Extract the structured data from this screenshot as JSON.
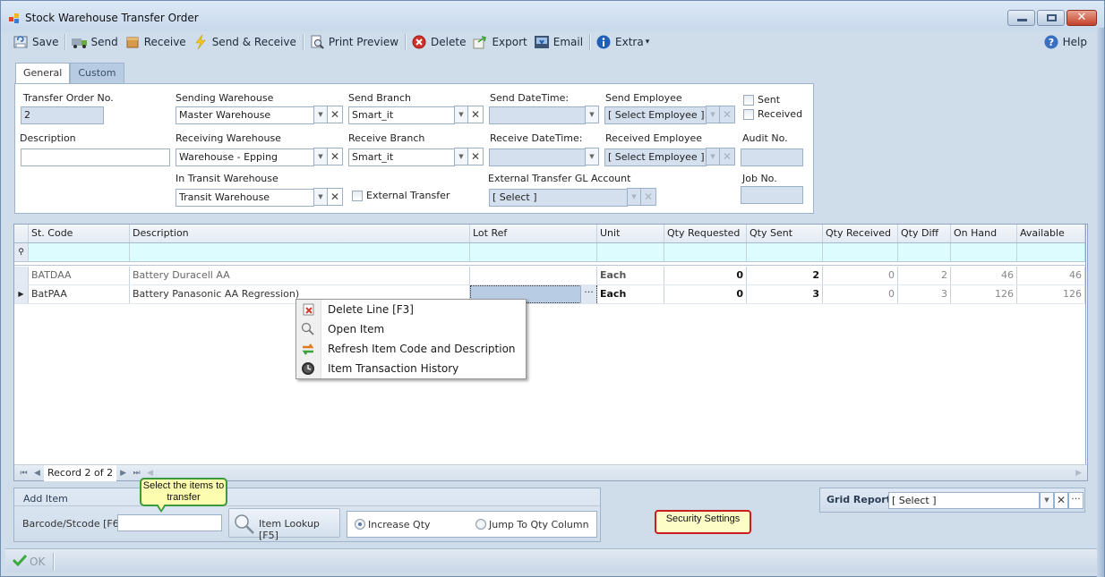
{
  "window": {
    "title": "Stock Warehouse Transfer Order",
    "controls": {
      "minimize": "minimize",
      "maximize": "maximize",
      "close": "✕"
    }
  },
  "toolbar": {
    "items": [
      {
        "label": "Save",
        "icon": "save-icon"
      },
      {
        "label": "Send",
        "icon": "truck-icon"
      },
      {
        "label": "Receive",
        "icon": "box-icon"
      },
      {
        "label": "Send & Receive",
        "icon": "lightning-icon"
      },
      {
        "label": "Print Preview",
        "icon": "print-preview-icon"
      },
      {
        "label": "Delete",
        "icon": "delete-icon"
      },
      {
        "label": "Export",
        "icon": "export-icon"
      },
      {
        "label": "Email",
        "icon": "email-icon"
      },
      {
        "label": "Extra",
        "icon": "info-icon",
        "dropdown": "▾"
      }
    ],
    "help": {
      "label": "Help",
      "icon": "help-icon"
    }
  },
  "tabs": [
    {
      "label": "General",
      "active": true
    },
    {
      "label": "Custom",
      "active": false
    }
  ],
  "general": {
    "transfer_order_no": {
      "label": "Transfer Order No.",
      "value": "2"
    },
    "description": {
      "label": "Description",
      "value": ""
    },
    "sending_warehouse": {
      "label": "Sending Warehouse",
      "value": "Master Warehouse"
    },
    "receiving_warehouse": {
      "label": "Receiving Warehouse",
      "value": "Warehouse - Epping"
    },
    "in_transit_warehouse": {
      "label": "In Transit Warehouse",
      "value": "Transit Warehouse"
    },
    "send_branch": {
      "label": "Send Branch",
      "value": "Smart_it"
    },
    "receive_branch": {
      "label": "Receive Branch",
      "value": "Smart_it"
    },
    "external_transfer": {
      "label": "External Transfer",
      "checked": false
    },
    "send_datetime": {
      "label": "Send DateTime:",
      "value": ""
    },
    "receive_datetime": {
      "label": "Receive DateTime:",
      "value": ""
    },
    "external_gl_account": {
      "label": "External Transfer GL Account",
      "value": "[ Select ]"
    },
    "send_employee": {
      "label": "Send Employee",
      "value": "[ Select Employee ]"
    },
    "received_employee": {
      "label": "Received Employee",
      "value": "[ Select Employee ]"
    },
    "sent": {
      "label": "Sent",
      "checked": false
    },
    "received": {
      "label": "Received",
      "checked": false
    },
    "audit_no": {
      "label": "Audit No.",
      "value": ""
    },
    "job_no": {
      "label": "Job No.",
      "value": ""
    }
  },
  "grid": {
    "columns": [
      "St. Code",
      "Description",
      "Lot Ref",
      "Unit",
      "Qty Requested",
      "Qty Sent",
      "Qty Received",
      "Qty Diff",
      "On Hand",
      "Available"
    ],
    "rows": [
      {
        "st_code": "BATDAA",
        "description": "Battery Duracell AA",
        "lot_ref": "",
        "unit": "Each",
        "qty_requested": "0",
        "qty_sent": "2",
        "qty_received": "0",
        "qty_diff": "2",
        "on_hand": "46",
        "available": "46"
      },
      {
        "st_code": "BatPAA",
        "description": "Battery Panasonic AA Regression)",
        "lot_ref": "",
        "unit": "Each",
        "qty_requested": "0",
        "qty_sent": "3",
        "qty_received": "0",
        "qty_diff": "3",
        "on_hand": "126",
        "available": "126"
      }
    ],
    "focused_row": 2,
    "navigator": {
      "record_text": "Record 2 of 2",
      "first": "⏮",
      "prev": "◀",
      "next": "▶",
      "last": "⏭"
    },
    "lot_ellipsis": "···"
  },
  "context_menu": {
    "items": [
      {
        "label": "Delete Line [F3]",
        "icon": "delete-line-icon"
      },
      {
        "label": "Open Item",
        "icon": "magnifier-icon"
      },
      {
        "label": "Refresh Item Code and Description",
        "icon": "refresh-icon"
      },
      {
        "label": "Item Transaction History",
        "icon": "history-clock-icon"
      }
    ]
  },
  "add_item": {
    "title": "Add Item",
    "barcode_label": "Barcode/Stcode [F6]",
    "barcode_value": "",
    "lookup_label": "Item Lookup [F5]",
    "radio_options": [
      {
        "label": "Increase Qty",
        "selected": true
      },
      {
        "label": "Jump To Qty Column",
        "selected": false
      }
    ]
  },
  "callouts": {
    "select_items": "Select the items to transfer",
    "security_settings": "Security Settings"
  },
  "grid_report": {
    "label": "Grid Report:",
    "value": "[ Select ]"
  },
  "statusbar": {
    "ok_label": "OK"
  },
  "colors": {
    "window_bg": "#cfdcea",
    "filter_row": "#dcfcfe",
    "callout_green_border": "#3b9a3b",
    "callout_red_border": "#c81e1e",
    "callout_fill": "#fdfdb0"
  }
}
